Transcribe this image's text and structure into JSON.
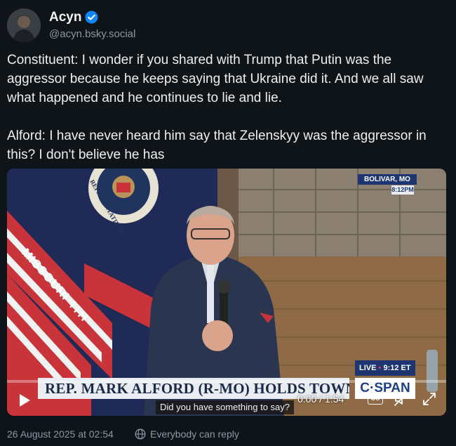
{
  "author": {
    "display_name": "Acyn",
    "handle": "@acyn.bsky.social",
    "verified_color": "#1185fe"
  },
  "post": {
    "text": "Constituent: I wonder if you shared with Trump that Putin was the aggressor because he keeps saying that Ukraine did it. And we all saw what happened and he continues to lie and lie.\n\nAlford: I have never heard him say that Zelenskyy was the aggressor in this? I don't believe he has"
  },
  "video": {
    "banner_text": "MISSOURI 4TH",
    "seal_text": "REPRESENTATIVES",
    "location": "BOLIVAR, MO",
    "location_time": "8:12PM",
    "chyron": "REP. MARK ALFORD (R-MO) HOLDS TOWN HALL",
    "network_logo": "C·SPAN",
    "live_label": "LIVE",
    "live_time": "9:12 ET",
    "caption": "Did you have something to say?",
    "current_time": "0:00",
    "duration": "1:54",
    "time_display": "0:00 / 1:54",
    "progress": 0,
    "cc_label": "CC",
    "icons": [
      "play-icon",
      "closed-captions-icon",
      "mute-icon",
      "fullscreen-icon"
    ]
  },
  "footer": {
    "timestamp": "26 August 2025 at 02:54",
    "reply_setting": "Everybody can reply",
    "reply_icon": "globe-icon"
  },
  "colors": {
    "background": "#0f1419",
    "secondary_text": "#8b98a5",
    "cspan_blue": "#1f3572"
  }
}
